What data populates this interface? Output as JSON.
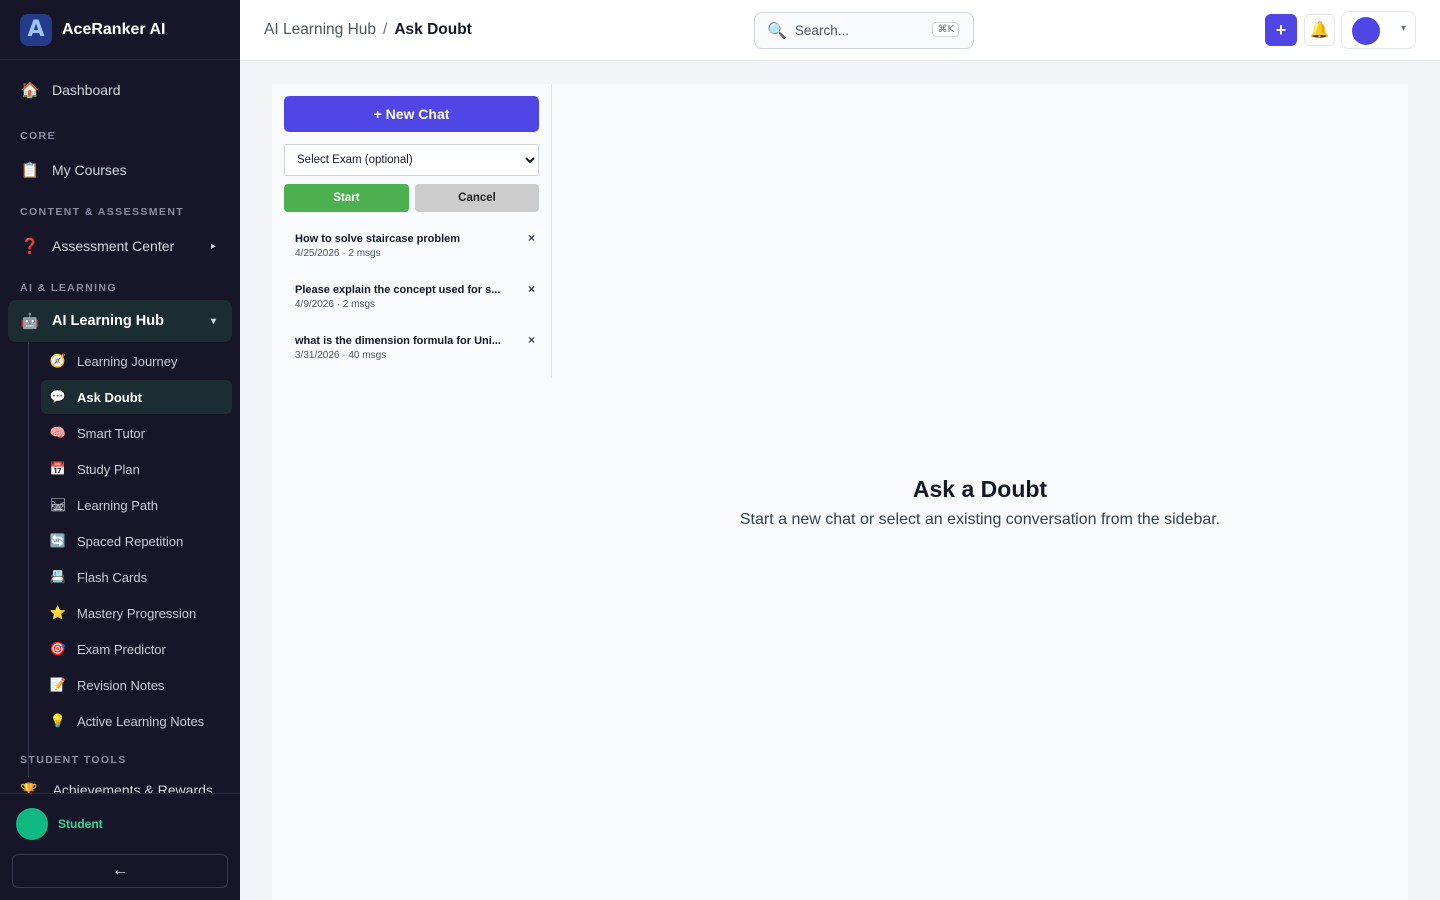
{
  "brand": {
    "logo_glyph": "A",
    "name": "AceRanker AI"
  },
  "sidebar": {
    "dashboard": {
      "icon": "🏠",
      "label": "Dashboard"
    },
    "sections": {
      "core": "CORE",
      "content": "CONTENT & ASSESSMENT",
      "ai": "AI & LEARNING",
      "tools": "STUDENT TOOLS"
    },
    "my_courses": {
      "icon": "📋",
      "label": "My Courses"
    },
    "assessment_center": {
      "icon": "❓",
      "label": "Assessment Center",
      "chevron": "▸"
    },
    "ai_hub": {
      "icon": "🤖",
      "label": "AI Learning Hub",
      "chevron": "▾"
    },
    "sub_items": [
      {
        "icon": "🧭",
        "label": "Learning Journey"
      },
      {
        "icon": "💬",
        "label": "Ask Doubt"
      },
      {
        "icon": "🧠",
        "label": "Smart Tutor"
      },
      {
        "icon": "📅",
        "label": "Study Plan"
      },
      {
        "icon": "🛤",
        "label": "Learning Path"
      },
      {
        "icon": "🔄",
        "label": "Spaced Repetition"
      },
      {
        "icon": "📇",
        "label": "Flash Cards"
      },
      {
        "icon": "⭐",
        "label": "Mastery Progression"
      },
      {
        "icon": "🎯",
        "label": "Exam Predictor"
      },
      {
        "icon": "📝",
        "label": "Revision Notes"
      },
      {
        "icon": "💡",
        "label": "Active Learning Notes"
      }
    ],
    "achievements": {
      "icon": "🏆",
      "label": "Achievements & Rewards"
    },
    "footer": {
      "role": "Student",
      "collapse_glyph": "←"
    }
  },
  "topbar": {
    "breadcrumb": {
      "parent": "AI Learning Hub",
      "separator": "/",
      "current": "Ask Doubt"
    },
    "search": {
      "icon": "🔍",
      "placeholder": "Search...",
      "shortcut": "⌘K"
    },
    "plus_glyph": "+",
    "bell_glyph": "🔔",
    "profile_caret": "▾"
  },
  "chat_panel": {
    "new_chat_label": "+ New Chat",
    "exam_select": {
      "selected": "Select Exam (optional)"
    },
    "start_label": "Start",
    "cancel_label": "Cancel",
    "close_glyph": "×",
    "conversations": [
      {
        "title": "How to solve staircase problem",
        "meta": "4/25/2026 · 2 msgs"
      },
      {
        "title": "Please explain the concept used for s...",
        "meta": "4/9/2026 · 2 msgs"
      },
      {
        "title": "what is the dimension formula for Uni...",
        "meta": "3/31/2026 · 40 msgs"
      }
    ]
  },
  "empty_state": {
    "title": "Ask a Doubt",
    "subtitle": "Start a new chat or select an existing conversation from the sidebar."
  },
  "colors": {
    "sidebar_bg": "#171628",
    "accent": "#4f46e5",
    "start_green": "#4caf50",
    "active_bg": "#1c2c33",
    "student_green": "#10b981"
  }
}
